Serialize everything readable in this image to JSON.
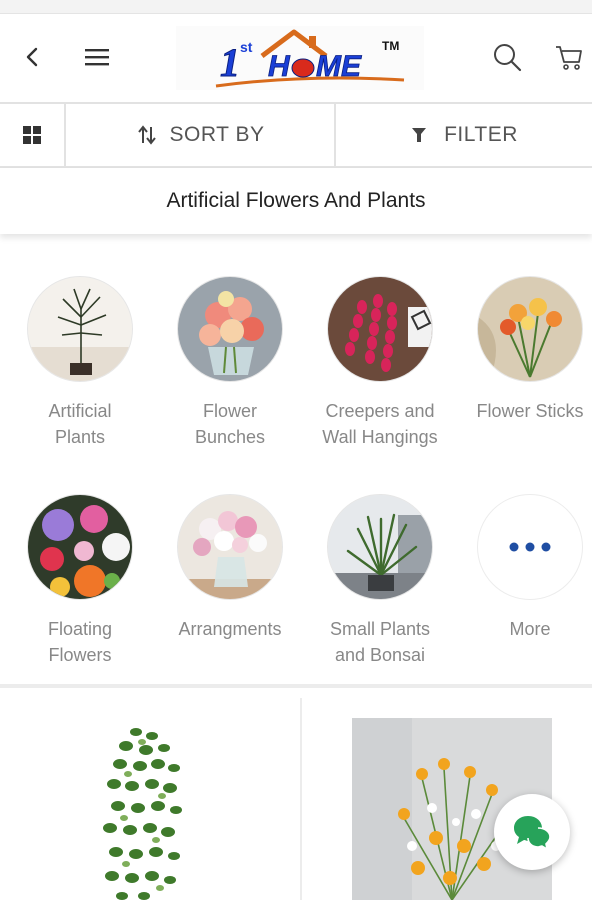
{
  "header": {
    "logo_text": "1st HOME",
    "logo_superscript": "st",
    "logo_trademark": "TM",
    "icons": [
      "back-arrow-icon",
      "hamburger-menu-icon",
      "search-icon",
      "cart-icon"
    ]
  },
  "toolbar": {
    "sort_label": "SORT BY",
    "filter_label": "FILTER",
    "icons": [
      "grid-view-icon",
      "sort-arrows-icon",
      "filter-funnel-icon"
    ]
  },
  "page": {
    "title": "Artificial Flowers And Plants"
  },
  "categories": [
    {
      "label": "Artificial Plants",
      "line1": "Artificial",
      "line2": "Plants"
    },
    {
      "label": "Flower Bunches",
      "line1": "Flower",
      "line2": "Bunches"
    },
    {
      "label": "Creepers and Wall Hangings",
      "line1": "Creepers and",
      "line2": "Wall Hangings"
    },
    {
      "label": "Flower Sticks",
      "line1": "Flower Sticks",
      "line2": ""
    },
    {
      "label": "Floating Flowers",
      "line1": "Floating",
      "line2": "Flowers"
    },
    {
      "label": "Arrangments",
      "line1": "Arrangments",
      "line2": ""
    },
    {
      "label": "Small Plants and Bonsai",
      "line1": "Small Plants",
      "line2": "and Bonsai"
    },
    {
      "label": "More",
      "line1": "More",
      "line2": ""
    }
  ],
  "colors": {
    "accent_blue": "#1f4ea3",
    "logo_blue": "#1a3fd6",
    "logo_orange": "#d86b1c",
    "label_gray": "#888888",
    "chat_green": "#27a35a"
  }
}
